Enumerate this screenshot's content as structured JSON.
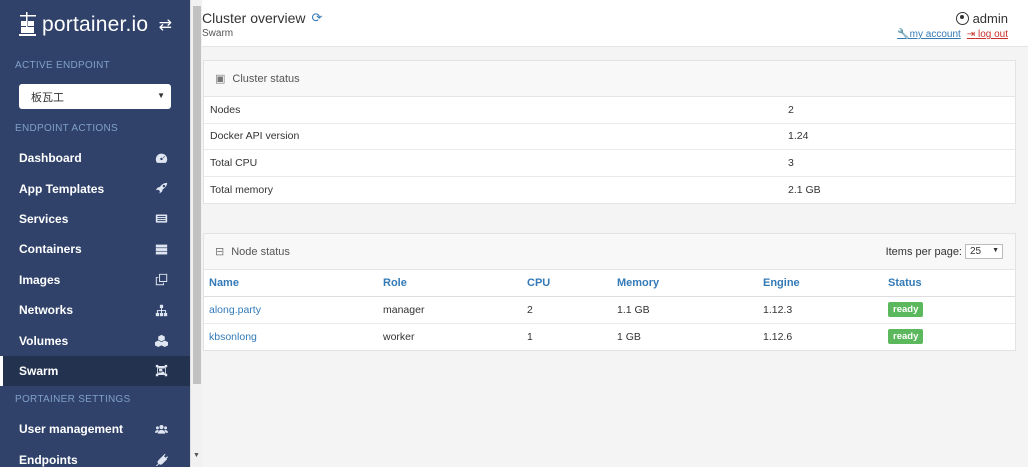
{
  "brand": {
    "name": "portainer.io"
  },
  "sidebar": {
    "active_endpoint_heading": "ACTIVE ENDPOINT",
    "endpoint_selected": "板瓦工",
    "endpoint_actions_heading": "ENDPOINT ACTIONS",
    "items": [
      {
        "label": "Dashboard",
        "icon": "dashboard-icon"
      },
      {
        "label": "App Templates",
        "icon": "rocket-icon"
      },
      {
        "label": "Services",
        "icon": "list-icon"
      },
      {
        "label": "Containers",
        "icon": "server-icon"
      },
      {
        "label": "Images",
        "icon": "clone-icon"
      },
      {
        "label": "Networks",
        "icon": "sitemap-icon"
      },
      {
        "label": "Volumes",
        "icon": "cubes-icon"
      },
      {
        "label": "Swarm",
        "icon": "object-group-icon"
      }
    ],
    "settings_heading": "PORTAINER SETTINGS",
    "settings_items": [
      {
        "label": "User management",
        "icon": "users-icon"
      },
      {
        "label": "Endpoints",
        "icon": "plug-icon"
      }
    ]
  },
  "header": {
    "title": "Cluster overview",
    "breadcrumb": "Swarm",
    "user": "admin",
    "my_account": "my account",
    "logout": "log out"
  },
  "cluster_status": {
    "title": "Cluster status",
    "rows": [
      {
        "key": "Nodes",
        "value": "2"
      },
      {
        "key": "Docker API version",
        "value": "1.24"
      },
      {
        "key": "Total CPU",
        "value": "3"
      },
      {
        "key": "Total memory",
        "value": "2.1 GB"
      }
    ]
  },
  "node_status": {
    "title": "Node status",
    "items_per_page_label": "Items per page:",
    "items_per_page_value": "25",
    "columns": [
      "Name",
      "Role",
      "CPU",
      "Memory",
      "Engine",
      "Status"
    ],
    "rows": [
      {
        "name": "along.party",
        "role": "manager",
        "cpu": "2",
        "memory": "1.1 GB",
        "engine": "1.12.3",
        "status": "ready"
      },
      {
        "name": "kbsonlong",
        "role": "worker",
        "cpu": "1",
        "memory": "1 GB",
        "engine": "1.12.6",
        "status": "ready"
      }
    ]
  },
  "colors": {
    "sidebar_bg": "#30426a",
    "accent": "#337ab7",
    "ready": "#5cb85c",
    "logout": "#c9302c"
  }
}
